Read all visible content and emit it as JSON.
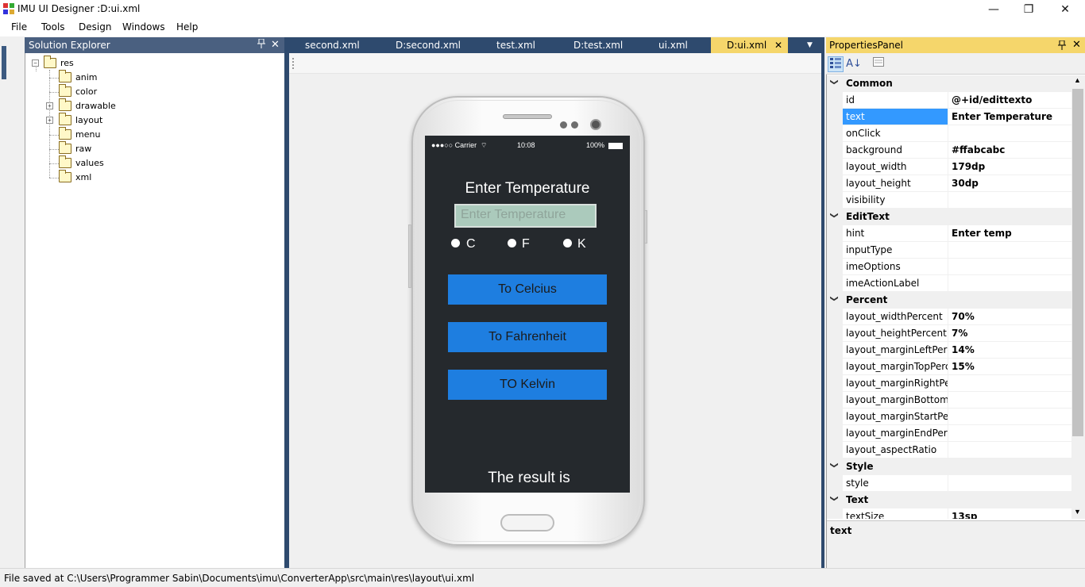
{
  "window": {
    "title": "IMU UI Designer :D:ui.xml",
    "minimize": "—",
    "maximize": "❐",
    "close": "✕"
  },
  "menu": [
    "File",
    "Tools",
    "Design",
    "Windows",
    "Help"
  ],
  "solution_explorer": {
    "title": "Solution Explorer",
    "pin": "📌",
    "close": "✕",
    "root": "res",
    "items": [
      "anim",
      "color",
      "drawable",
      "layout",
      "menu",
      "raw",
      "values",
      "xml"
    ]
  },
  "tabs": [
    "second.xml",
    "D:second.xml",
    "test.xml",
    "D:test.xml",
    "ui.xml",
    "D:ui.xml"
  ],
  "active_tab": "D:ui.xml",
  "tab_close": "✕",
  "tab_dropdown": "▼",
  "phone": {
    "carrier": "●●●○○ Carrier",
    "time": "10:08",
    "battery": "100%",
    "title": "Enter Temperature",
    "edit_hint": "Enter Temperature",
    "radios": [
      "C",
      "F",
      "K"
    ],
    "buttons": [
      "To Celcius",
      "To Fahrenheit",
      "TO Kelvin"
    ],
    "result": "The result is"
  },
  "properties": {
    "title": "PropertiesPanel",
    "pin": "📌",
    "close": "✕",
    "selected_row": "text",
    "rows": [
      {
        "type": "cat",
        "name": "Common"
      },
      {
        "name": "id",
        "value": "@+id/edittexto"
      },
      {
        "name": "text",
        "value": "Enter Temperature"
      },
      {
        "name": "onClick",
        "value": ""
      },
      {
        "name": "background",
        "value": "#ffabcabc"
      },
      {
        "name": "layout_width",
        "value": "179dp"
      },
      {
        "name": "layout_height",
        "value": "30dp"
      },
      {
        "name": "visibility",
        "value": ""
      },
      {
        "type": "cat",
        "name": "EditText"
      },
      {
        "name": "hint",
        "value": "Enter temp"
      },
      {
        "name": "inputType",
        "value": ""
      },
      {
        "name": "imeOptions",
        "value": ""
      },
      {
        "name": "imeActionLabel",
        "value": ""
      },
      {
        "type": "cat",
        "name": "Percent"
      },
      {
        "name": "layout_widthPercent",
        "value": "70%"
      },
      {
        "name": "layout_heightPercent",
        "value": "7%"
      },
      {
        "name": "layout_marginLeftPercent",
        "value": "14%"
      },
      {
        "name": "layout_marginTopPercent",
        "value": "15%"
      },
      {
        "name": "layout_marginRightPercent",
        "value": ""
      },
      {
        "name": "layout_marginBottomPercent",
        "value": ""
      },
      {
        "name": "layout_marginStartPercent",
        "value": ""
      },
      {
        "name": "layout_marginEndPercent",
        "value": ""
      },
      {
        "name": "layout_aspectRatio",
        "value": ""
      },
      {
        "type": "cat",
        "name": "Style"
      },
      {
        "name": "style",
        "value": ""
      },
      {
        "type": "cat",
        "name": "Text"
      },
      {
        "name": "textSize",
        "value": "13sp"
      }
    ],
    "description": "text",
    "scroll_up": "▲",
    "scroll_down": "▼"
  },
  "statusbar": "File saved at C:\\Users\\Programmer Sabin\\Documents\\imu\\ConverterApp\\src\\main\\res\\layout\\ui.xml",
  "colors": {
    "panel_header": "#4a6080",
    "tab_strip": "#2e4a6e",
    "active_tab": "#f5d66b",
    "phone_screen": "#25292d",
    "edit_background": "#abcabc",
    "button_blue": "#1e7ee0",
    "selection": "#3399ff"
  }
}
